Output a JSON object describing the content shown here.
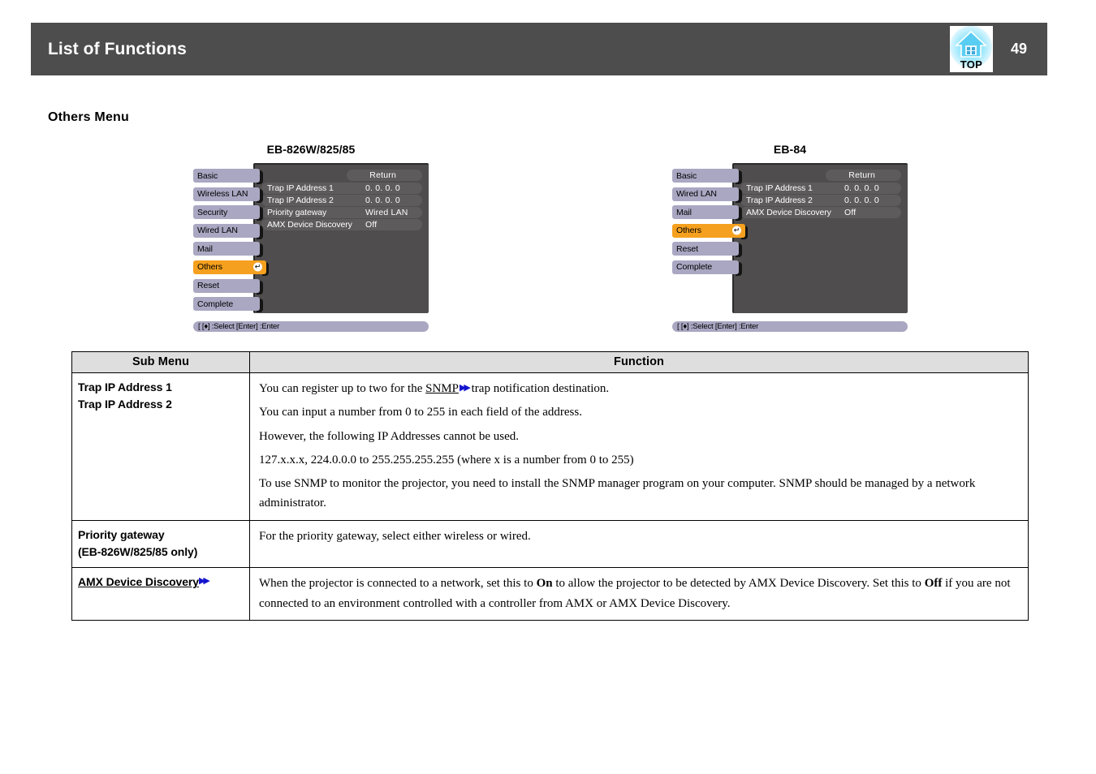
{
  "header": {
    "title": "List of Functions",
    "page_number": "49",
    "top_icon_label": "TOP"
  },
  "section": {
    "title": "Others  Menu"
  },
  "figures": [
    {
      "caption": "EB-826W/825/85",
      "sidebar": [
        {
          "label": "Basic",
          "selected": false
        },
        {
          "label": "Wireless LAN",
          "selected": false
        },
        {
          "label": "Security",
          "selected": false
        },
        {
          "label": "Wired LAN",
          "selected": false
        },
        {
          "label": "Mail",
          "selected": false
        },
        {
          "label": "Others",
          "selected": true
        },
        {
          "label": "Reset",
          "selected": false
        },
        {
          "label": "Complete",
          "selected": false
        }
      ],
      "return_label": "Return",
      "rows": [
        {
          "label": "Trap IP Address 1",
          "value": "0.    0.    0.    0"
        },
        {
          "label": "Trap IP Address 2",
          "value": "0.    0.    0.    0"
        },
        {
          "label": "Priority gateway",
          "value": "Wired LAN"
        },
        {
          "label": "AMX Device Discovery",
          "value": "Off"
        }
      ],
      "hint": "[ [♦] :Select  [Enter] :Enter"
    },
    {
      "caption": "EB-84",
      "sidebar": [
        {
          "label": "Basic",
          "selected": false
        },
        {
          "label": "Wired LAN",
          "selected": false
        },
        {
          "label": "Mail",
          "selected": false
        },
        {
          "label": "Others",
          "selected": true
        },
        {
          "label": "Reset",
          "selected": false
        },
        {
          "label": "Complete",
          "selected": false
        }
      ],
      "return_label": "Return",
      "rows": [
        {
          "label": "Trap IP Address 1",
          "value": "0.    0.    0.    0"
        },
        {
          "label": "Trap IP Address 2",
          "value": "0.    0.    0.    0"
        },
        {
          "label": "AMX Device Discovery",
          "value": "Off"
        }
      ],
      "hint": "[ [♦] :Select  [Enter] :Enter"
    }
  ],
  "table": {
    "headers": {
      "sub_menu": "Sub Menu",
      "function": "Function"
    },
    "rows": [
      {
        "sub_menu_line1": "Trap IP Address 1",
        "sub_menu_line2": "Trap IP Address 2",
        "paragraphs": {
          "p1_before": "You can register up to two for the ",
          "p1_link": "SNMP",
          "p1_after": " trap notification destination.",
          "p2": "You can input a number from 0 to 255 in each field of the address.",
          "p3": "However, the following IP Addresses cannot be used.",
          "p4": "127.x.x.x, 224.0.0.0 to 255.255.255.255 (where x is a number from 0 to 255)",
          "p5": "To use SNMP to monitor the projector, you need to install the SNMP manager program on your computer. SNMP should be managed by a network administrator."
        }
      },
      {
        "sub_menu_line1": "Priority gateway",
        "sub_menu_line2": "(EB-826W/825/85 only)",
        "paragraphs": {
          "p1": "For the priority gateway, select either wireless or wired."
        }
      },
      {
        "sub_menu_line1": "AMX Device Discovery",
        "paragraphs": {
          "seg1": "When the projector is connected to a network, set this to ",
          "bold1": "On",
          "seg2": " to allow the projector to be detected by AMX Device Discovery. Set this to ",
          "bold2": "Off",
          "seg3": " if you are not connected to an environment controlled with a controller from AMX or AMX Device Discovery."
        }
      }
    ]
  },
  "colors": {
    "header_bg": "#4d4d4d",
    "osd_panel": "#4f4d4d",
    "osd_item": "#a9a7c2",
    "osd_selected": "#f5a01e",
    "table_header_bg": "#dedede",
    "link_arrow": "#1414cf"
  }
}
